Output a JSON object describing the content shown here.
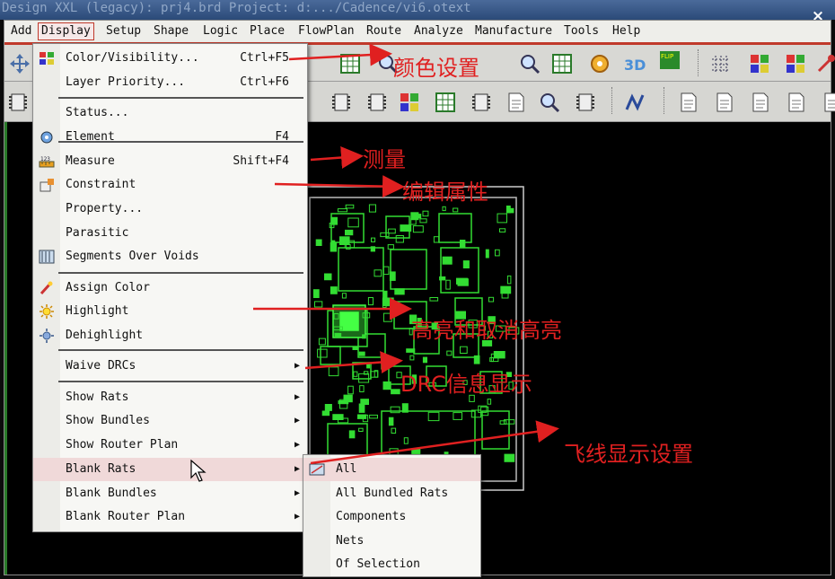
{
  "window": {
    "title": "Design XXL (legacy): prj4.brd  Project: d:.../Cadence/vi6.otext",
    "close_glyph": "×"
  },
  "menubar": {
    "items": [
      "Add",
      "Display",
      "Setup",
      "Shape",
      "Logic",
      "Place",
      "FlowPlan",
      "Route",
      "Analyze",
      "Manufacture",
      "Tools",
      "Help"
    ],
    "active": "Display"
  },
  "display_menu": {
    "items": [
      {
        "label": "Color/Visibility...",
        "shortcut": "Ctrl+F5",
        "icon": "color-visibility-icon"
      },
      {
        "label": "Layer Priority...",
        "shortcut": "Ctrl+F6",
        "icon": ""
      },
      {
        "label": "Status...",
        "shortcut": "",
        "icon": ""
      },
      {
        "label": "Element",
        "shortcut": "F4",
        "icon": "element-icon"
      },
      {
        "label": "Measure",
        "shortcut": "Shift+F4",
        "icon": "measure-icon"
      },
      {
        "label": "Constraint",
        "shortcut": "",
        "icon": "constraint-icon"
      },
      {
        "label": "Property...",
        "shortcut": "",
        "icon": ""
      },
      {
        "label": "Parasitic",
        "shortcut": "",
        "icon": ""
      },
      {
        "label": "Segments Over Voids",
        "shortcut": "",
        "icon": "segments-icon"
      },
      {
        "label": "Assign Color",
        "shortcut": "",
        "icon": "assign-color-icon"
      },
      {
        "label": "Highlight",
        "shortcut": "",
        "icon": "highlight-icon"
      },
      {
        "label": "Dehighlight",
        "shortcut": "",
        "icon": "dehighlight-icon"
      },
      {
        "label": "Waive DRCs",
        "shortcut": "",
        "icon": "",
        "submenu": true
      },
      {
        "label": "Show Rats",
        "shortcut": "",
        "icon": "",
        "submenu": true
      },
      {
        "label": "Show Bundles",
        "shortcut": "",
        "icon": "",
        "submenu": true
      },
      {
        "label": "Show Router Plan",
        "shortcut": "",
        "icon": "",
        "submenu": true
      },
      {
        "label": "Blank Rats",
        "shortcut": "",
        "icon": "",
        "submenu": true
      },
      {
        "label": "Blank Bundles",
        "shortcut": "",
        "icon": "",
        "submenu": true
      },
      {
        "label": "Blank Router Plan",
        "shortcut": "",
        "icon": "",
        "submenu": true
      }
    ],
    "hovered": "Blank Rats"
  },
  "blank_rats_submenu": {
    "items": [
      "All",
      "All Bundled Rats",
      "Components",
      "Nets",
      "Of Selection"
    ]
  },
  "annotations": {
    "color_settings": "颜色设置",
    "measure": "测量",
    "edit_property": "编辑属性",
    "highlight": "高亮和取消高亮",
    "drc": "DRC信息显示",
    "rats": "飞线显示设置"
  },
  "colors": {
    "annotation": "#e02020",
    "pcb_green": "#33dd33",
    "menubar_border": "#c0392b"
  }
}
